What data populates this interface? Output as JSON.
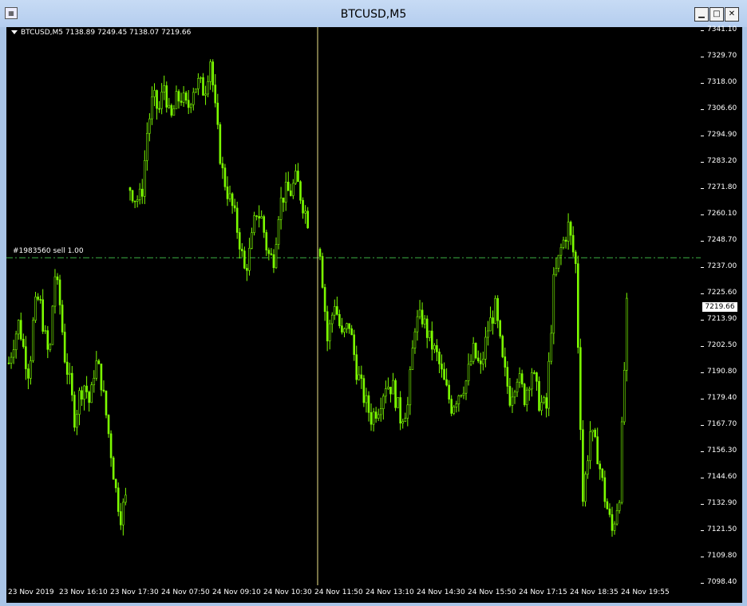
{
  "window": {
    "title": "BTCUSD,M5",
    "icon": "chart-window-icon",
    "minimize": "▁",
    "maximize": "□",
    "close": "✕"
  },
  "chart": {
    "symbol_header": "BTCUSD,M5  7138.89 7249.45 7138.07 7219.66",
    "order_label": "#1983560 sell 1.00",
    "current_price": "7219.66",
    "colors": {
      "background": "#000000",
      "candle": "#7CFC00",
      "order_line": "#3cb043",
      "crosshair": "#f0e68c"
    }
  },
  "chart_data": {
    "type": "candlestick",
    "symbol": "BTCUSD",
    "timeframe": "M5",
    "ohlc_header": {
      "open": 7138.89,
      "high": 7249.45,
      "low": 7138.07,
      "close": 7219.66
    },
    "current_price": 7219.66,
    "order_line": {
      "label": "#1983560 sell 1.00",
      "price": 7241.2
    },
    "ylim": [
      7098.4,
      7341.1
    ],
    "price_ticks": [
      "7341.10",
      "7329.70",
      "7318.00",
      "7306.60",
      "7294.90",
      "7283.20",
      "7271.80",
      "7260.10",
      "7248.70",
      "7237.00",
      "7225.60",
      "7213.90",
      "7202.50",
      "7190.80",
      "7179.40",
      "7167.70",
      "7156.30",
      "7144.60",
      "7132.90",
      "7121.50",
      "7109.80",
      "7098.40"
    ],
    "time_labels": [
      "23 Nov 2019",
      "23 Nov 16:10",
      "23 Nov 17:30",
      "24 Nov 07:50",
      "24 Nov 09:10",
      "24 Nov 10:30",
      "24 Nov 11:50",
      "24 Nov 13:10",
      "24 Nov 14:30",
      "24 Nov 15:50",
      "24 Nov 17:15",
      "24 Nov 18:35",
      "24 Nov 19:55"
    ],
    "path_closes": [
      [
        7195,
        7205,
        7213,
        7200,
        7190,
        7218,
        7224,
        7208,
        7196,
        7235,
        7222,
        7198,
        7186,
        7170,
        7182,
        7186,
        7176,
        7196,
        7190,
        7175,
        7158,
        7140,
        7128,
        7135
      ],
      [
        7272,
        7267,
        7268,
        7297,
        7312,
        7305,
        7318,
        7300,
        7310,
        7312,
        7306,
        7316,
        7318,
        7314,
        7329,
        7302,
        7280,
        7270,
        7262,
        7250,
        7235,
        7245,
        7262,
        7258,
        7243,
        7240,
        7264,
        7270,
        7270,
        7276,
        7266,
        7258
      ],
      [
        7245,
        7205,
        7222,
        7206,
        7212,
        7192,
        7180,
        7171,
        7176,
        7186,
        7184,
        7171,
        7176,
        7212,
        7215,
        7205,
        7198,
        7186,
        7176,
        7182,
        7187,
        7200,
        7192,
        7210,
        7219,
        7195,
        7180,
        7190,
        7180,
        7192,
        7178,
        7175,
        7230,
        7245,
        7255,
        7238,
        7135,
        7165,
        7155,
        7136,
        7121,
        7138,
        7219
      ]
    ]
  }
}
